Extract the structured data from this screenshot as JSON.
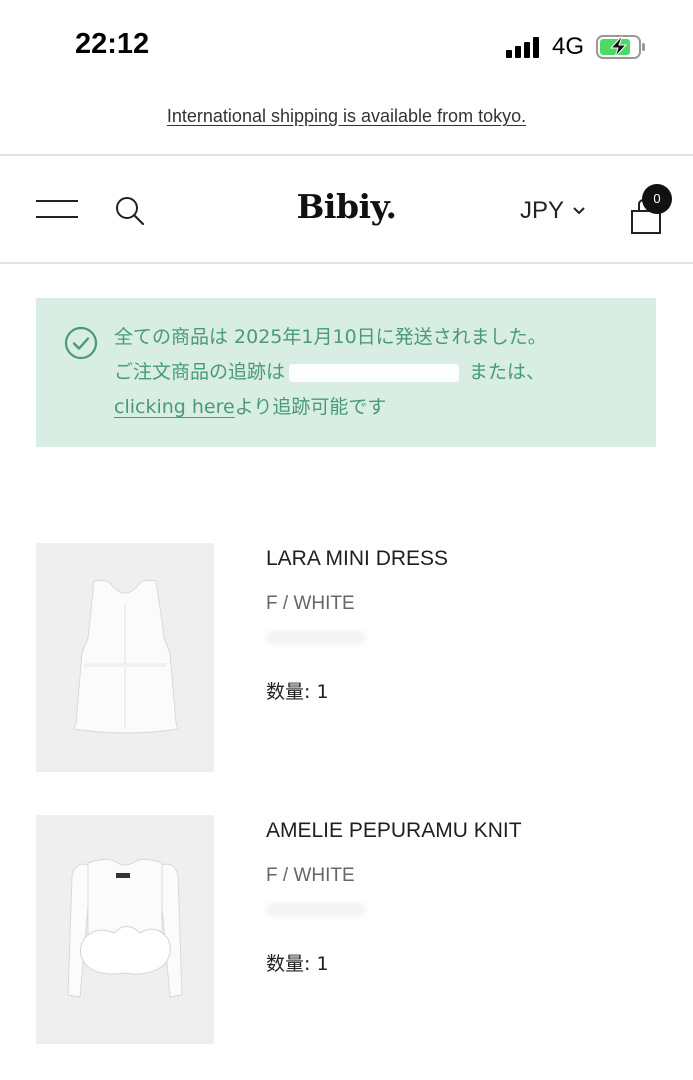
{
  "status_bar": {
    "time": "22:12",
    "network": "4G",
    "icons": [
      "signal-icon",
      "battery-charging-icon"
    ]
  },
  "announcement": {
    "text": "International shipping is available from tokyo."
  },
  "header": {
    "logo": "Bibiy.",
    "currency": "JPY",
    "cart_count": "0",
    "icons": [
      "menu-icon",
      "search-icon",
      "chevron-down-icon",
      "cart-icon"
    ]
  },
  "notice": {
    "line1": "全ての商品は 2025年1月10日に発送されました。",
    "line2_prefix": "ご注文商品の追跡は",
    "line2_suffix": " または、",
    "link": "clicking here",
    "line3_suffix": "より追跡可能です",
    "accent_color": "#4a9a78",
    "background_color": "#d8ede3",
    "icon": "check-circle-icon"
  },
  "products": [
    {
      "name": "LARA MINI DRESS",
      "variant": "F / WHITE",
      "quantity": "数量: 1"
    },
    {
      "name": "AMELIE PEPURAMU KNIT",
      "variant": "F / WHITE",
      "quantity": "数量: 1"
    }
  ]
}
